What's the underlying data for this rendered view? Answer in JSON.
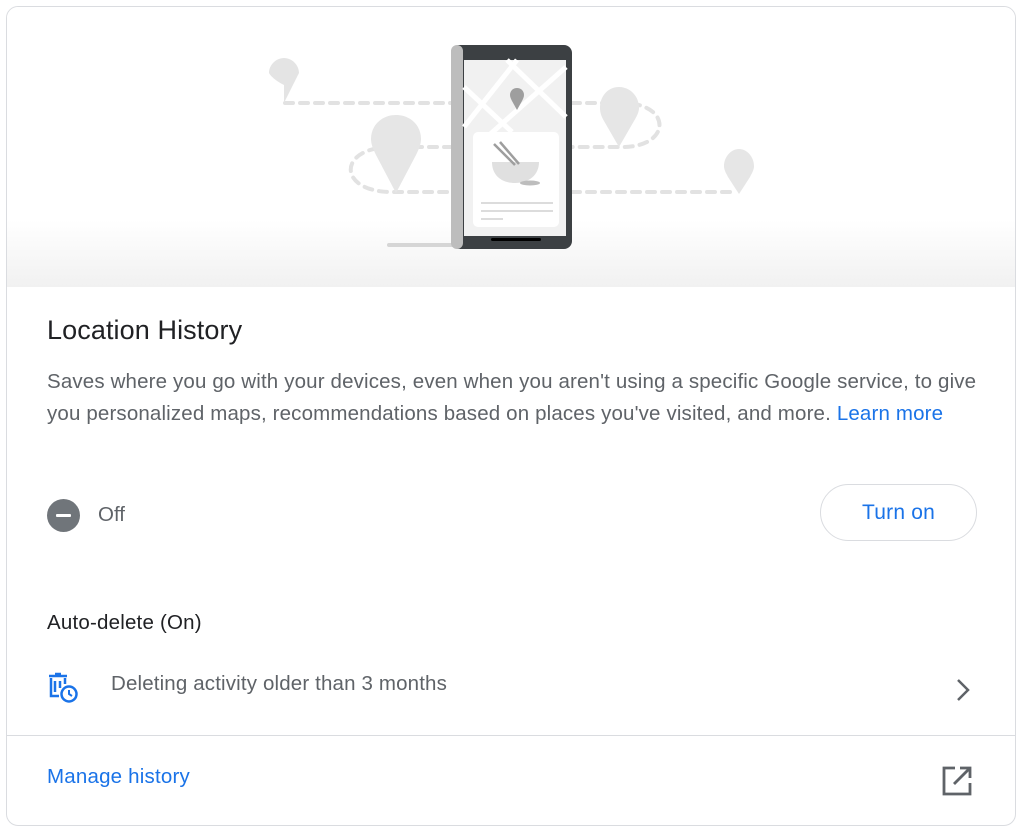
{
  "card": {
    "title": "Location History",
    "description": "Saves where you go with your devices, even when you aren't using a specific Google service, to give you personalized maps, recommendations based on places you've visited, and more.",
    "learn_more_label": "Learn more",
    "status": {
      "icon": "off-circle-icon",
      "label": "Off"
    },
    "turn_on_label": "Turn on",
    "auto_delete": {
      "title": "Auto-delete (On)",
      "icon": "auto-delete-icon",
      "detail": "Deleting activity older than 3 months"
    },
    "manage_history_label": "Manage history"
  },
  "colors": {
    "accent": "#1a73e8",
    "text_primary": "#202124",
    "text_secondary": "#5f6368",
    "status_off": "#70757a",
    "divider": "#dadce0"
  }
}
